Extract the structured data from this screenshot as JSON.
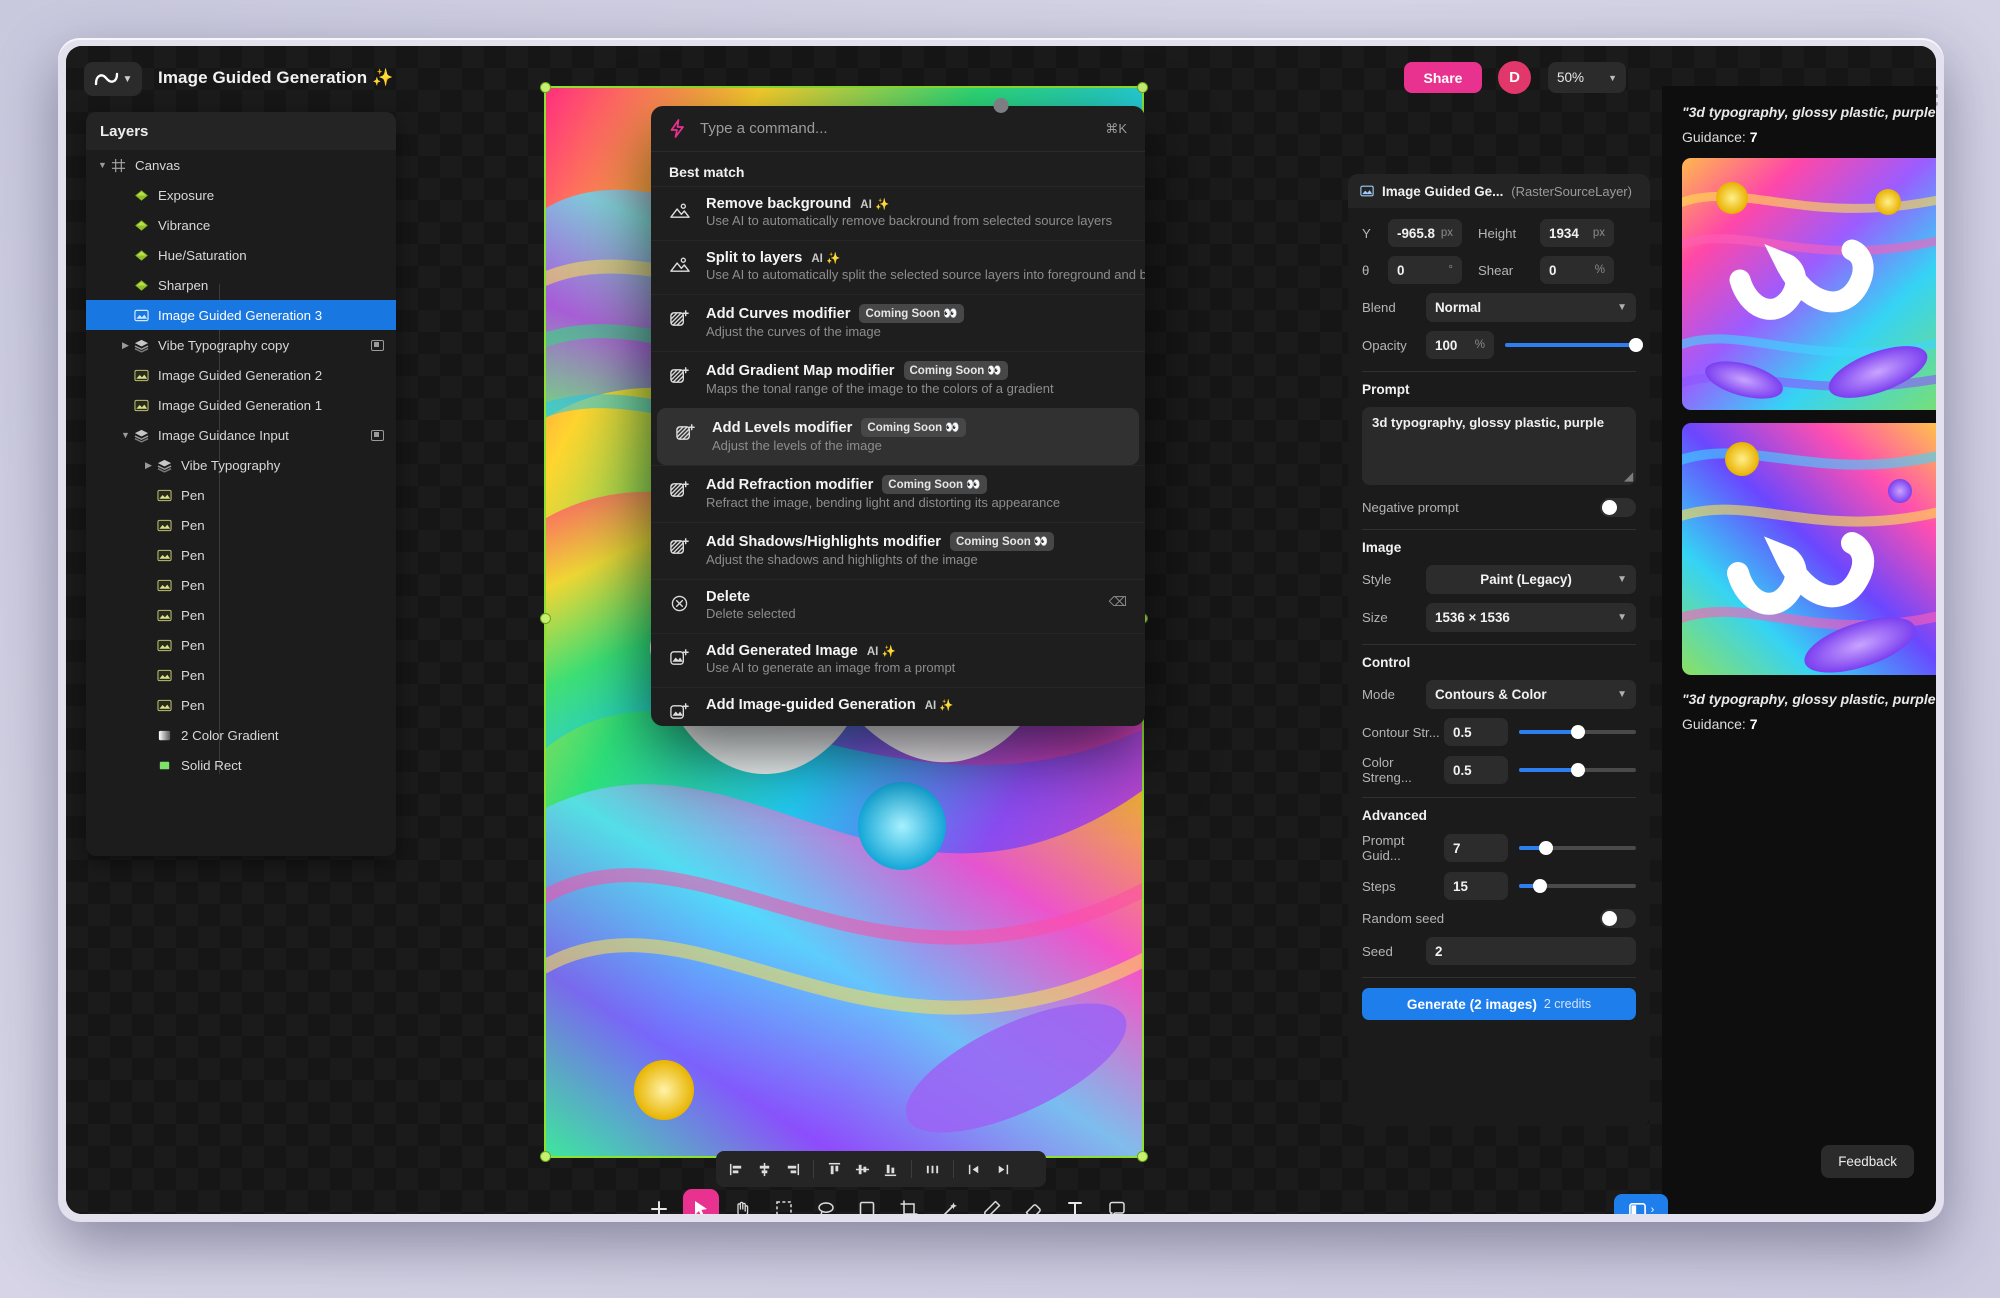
{
  "topbar": {
    "logo_icon": "infinity-logo-icon",
    "caret_icon": "chevron-down-icon",
    "title": "Image Guided Generation ✨",
    "share_label": "Share",
    "avatar_initial": "D",
    "zoom_value": "50%"
  },
  "layers": {
    "header": "Layers",
    "items": [
      {
        "label": "Canvas",
        "icon": "grid-icon",
        "indent": 0,
        "caret": "▼",
        "selected": false,
        "badge": false
      },
      {
        "label": "Exposure",
        "icon": "adjustment-icon",
        "indent": 1,
        "caret": "",
        "selected": false,
        "badge": false
      },
      {
        "label": "Vibrance",
        "icon": "adjustment-icon",
        "indent": 1,
        "caret": "",
        "selected": false,
        "badge": false
      },
      {
        "label": "Hue/Saturation",
        "icon": "adjustment-icon",
        "indent": 1,
        "caret": "",
        "selected": false,
        "badge": false
      },
      {
        "label": "Sharpen",
        "icon": "adjustment-icon",
        "indent": 1,
        "caret": "",
        "selected": false,
        "badge": false
      },
      {
        "label": "Image Guided Generation 3",
        "icon": "image-layer-icon",
        "indent": 1,
        "caret": "",
        "selected": true,
        "badge": false
      },
      {
        "label": "Vibe Typography copy",
        "icon": "group-icon",
        "indent": 1,
        "caret": "▶",
        "selected": false,
        "badge": true
      },
      {
        "label": "Image Guided Generation 2",
        "icon": "raster-icon",
        "indent": 1,
        "caret": "",
        "selected": false,
        "badge": false
      },
      {
        "label": "Image Guided Generation 1",
        "icon": "raster-icon",
        "indent": 1,
        "caret": "",
        "selected": false,
        "badge": false
      },
      {
        "label": "Image Guidance Input",
        "icon": "group-icon",
        "indent": 1,
        "caret": "▼",
        "selected": false,
        "badge": true
      },
      {
        "label": "Vibe Typography",
        "icon": "group-icon",
        "indent": 2,
        "caret": "▶",
        "selected": false,
        "badge": false
      },
      {
        "label": "Pen",
        "icon": "raster-icon",
        "indent": 2,
        "caret": "",
        "selected": false,
        "badge": false
      },
      {
        "label": "Pen",
        "icon": "raster-icon",
        "indent": 2,
        "caret": "",
        "selected": false,
        "badge": false
      },
      {
        "label": "Pen",
        "icon": "raster-icon",
        "indent": 2,
        "caret": "",
        "selected": false,
        "badge": false
      },
      {
        "label": "Pen",
        "icon": "raster-icon",
        "indent": 2,
        "caret": "",
        "selected": false,
        "badge": false
      },
      {
        "label": "Pen",
        "icon": "raster-icon",
        "indent": 2,
        "caret": "",
        "selected": false,
        "badge": false
      },
      {
        "label": "Pen",
        "icon": "raster-icon",
        "indent": 2,
        "caret": "",
        "selected": false,
        "badge": false
      },
      {
        "label": "Pen",
        "icon": "raster-icon",
        "indent": 2,
        "caret": "",
        "selected": false,
        "badge": false
      },
      {
        "label": "Pen",
        "icon": "raster-icon",
        "indent": 2,
        "caret": "",
        "selected": false,
        "badge": false
      },
      {
        "label": "2 Color Gradient",
        "icon": "gradient-icon",
        "indent": 2,
        "caret": "",
        "selected": false,
        "badge": false
      },
      {
        "label": "Solid Rect",
        "icon": "rect-icon",
        "indent": 2,
        "caret": "",
        "selected": false,
        "badge": false
      }
    ]
  },
  "palette": {
    "placeholder": "Type a command...",
    "shortcut": "⌘K",
    "section_label": "Best match",
    "commands": [
      {
        "title": "Remove background",
        "desc": "Use AI to automatically remove backround from selected source layers",
        "tag": "AI ✨",
        "tag_type": "ai",
        "icon": "remove-background-icon",
        "highlight": false,
        "kbd": ""
      },
      {
        "title": "Split to layers",
        "desc": "Use AI to automatically split the selected source layers into foreground and backg",
        "tag": "AI ✨",
        "tag_type": "ai",
        "icon": "split-layers-icon",
        "highlight": false,
        "kbd": ""
      },
      {
        "title": "Add Curves modifier",
        "desc": "Adjust the curves of the image",
        "tag": "Coming Soon 👀",
        "tag_type": "soon",
        "icon": "add-modifier-icon",
        "highlight": false,
        "kbd": ""
      },
      {
        "title": "Add Gradient Map modifier",
        "desc": "Maps the tonal range of the image to the colors of a gradient",
        "tag": "Coming Soon 👀",
        "tag_type": "soon",
        "icon": "add-modifier-icon",
        "highlight": false,
        "kbd": ""
      },
      {
        "title": "Add Levels modifier",
        "desc": "Adjust the levels of the image",
        "tag": "Coming Soon 👀",
        "tag_type": "soon",
        "icon": "add-modifier-icon",
        "highlight": true,
        "kbd": ""
      },
      {
        "title": "Add Refraction modifier",
        "desc": "Refract the image, bending light and distorting its appearance",
        "tag": "Coming Soon 👀",
        "tag_type": "soon",
        "icon": "add-modifier-icon",
        "highlight": false,
        "kbd": ""
      },
      {
        "title": "Add Shadows/Highlights modifier",
        "desc": "Adjust the shadows and highlights of the image",
        "tag": "Coming Soon 👀",
        "tag_type": "soon",
        "icon": "add-modifier-icon",
        "highlight": false,
        "kbd": ""
      },
      {
        "title": "Delete",
        "desc": "Delete selected",
        "tag": "",
        "tag_type": "",
        "icon": "delete-icon",
        "highlight": false,
        "kbd": "⌫"
      },
      {
        "title": "Add Generated Image",
        "desc": "Use AI to generate an image from a prompt",
        "tag": "AI ✨",
        "tag_type": "ai",
        "icon": "add-generated-image-icon",
        "highlight": false,
        "kbd": ""
      },
      {
        "title": "Add Image-guided Generation",
        "desc": "",
        "tag": "AI ✨",
        "tag_type": "ai",
        "icon": "add-generated-image-icon",
        "highlight": false,
        "kbd": ""
      }
    ]
  },
  "align_toolbar": {
    "buttons": [
      "align-left-icon",
      "align-center-h-icon",
      "align-right-icon",
      "align-top-icon",
      "align-middle-v-icon",
      "align-bottom-icon",
      "distribute-h-icon",
      "distribute-v-icon",
      "flip-icon"
    ]
  },
  "tool_dock": {
    "tools": [
      {
        "icon": "add-icon",
        "active": false
      },
      {
        "icon": "cursor-select-icon",
        "active": true
      },
      {
        "icon": "hand-pan-icon",
        "active": false
      },
      {
        "icon": "marquee-select-icon",
        "active": false
      },
      {
        "icon": "lasso-select-icon",
        "active": false
      },
      {
        "icon": "rectangle-icon",
        "active": false
      },
      {
        "icon": "crop-icon",
        "active": false
      },
      {
        "icon": "magic-wand-icon",
        "active": false
      },
      {
        "icon": "pen-icon",
        "active": false
      },
      {
        "icon": "eraser-icon",
        "active": false
      },
      {
        "icon": "text-icon",
        "active": false
      },
      {
        "icon": "comment-icon",
        "active": false
      }
    ]
  },
  "properties": {
    "header_icon": "raster-icon",
    "header_title": "Image Guided Ge...",
    "header_type": "(RasterSourceLayer)",
    "transform": {
      "y_label": "Y",
      "y_value": "-965.8",
      "y_unit": "px",
      "height_label": "Height",
      "height_value": "1934",
      "height_unit": "px",
      "theta_label": "θ",
      "theta_value": "0",
      "theta_unit": "°",
      "shear_label": "Shear",
      "shear_value": "0",
      "shear_unit": "%"
    },
    "blend_label": "Blend",
    "blend_value": "Normal",
    "opacity_label": "Opacity",
    "opacity_value": "100",
    "opacity_unit": "%",
    "opacity_pct": 100,
    "prompt_section": "Prompt",
    "prompt_value": "3d typography, glossy plastic, purple",
    "negative_prompt_label": "Negative prompt",
    "negative_prompt_on": false,
    "image_section": "Image",
    "style_label": "Style",
    "style_value": "Paint (Legacy)",
    "size_label": "Size",
    "size_value": "1536 × 1536",
    "control_section": "Control",
    "mode_label": "Mode",
    "mode_value": "Contours & Color",
    "contour_label": "Contour Str...",
    "contour_value": "0.5",
    "contour_pct": 50,
    "color_strength_label": "Color Streng...",
    "color_strength_value": "0.5",
    "color_strength_pct": 50,
    "advanced_section": "Advanced",
    "prompt_guidance_label": "Prompt Guid...",
    "prompt_guidance_value": "7",
    "prompt_guidance_pct": 23,
    "steps_label": "Steps",
    "steps_value": "15",
    "steps_pct": 18,
    "random_seed_label": "Random seed",
    "random_seed_on": false,
    "seed_label": "Seed",
    "seed_value": "2",
    "generate_label": "Generate (2 images)",
    "generate_credits": "2 credits"
  },
  "rail": {
    "results": [
      {
        "prompt": "\"3d typography, glossy plastic, purple\"",
        "guidance_label": "Guidance:",
        "guidance_value": "7"
      },
      {
        "prompt": "\"3d typography, glossy plastic, purple\"",
        "guidance_label": "Guidance:",
        "guidance_value": "7"
      }
    ],
    "feedback_label": "Feedback",
    "panel_toggle_icon": "panel-toggle-icon"
  }
}
